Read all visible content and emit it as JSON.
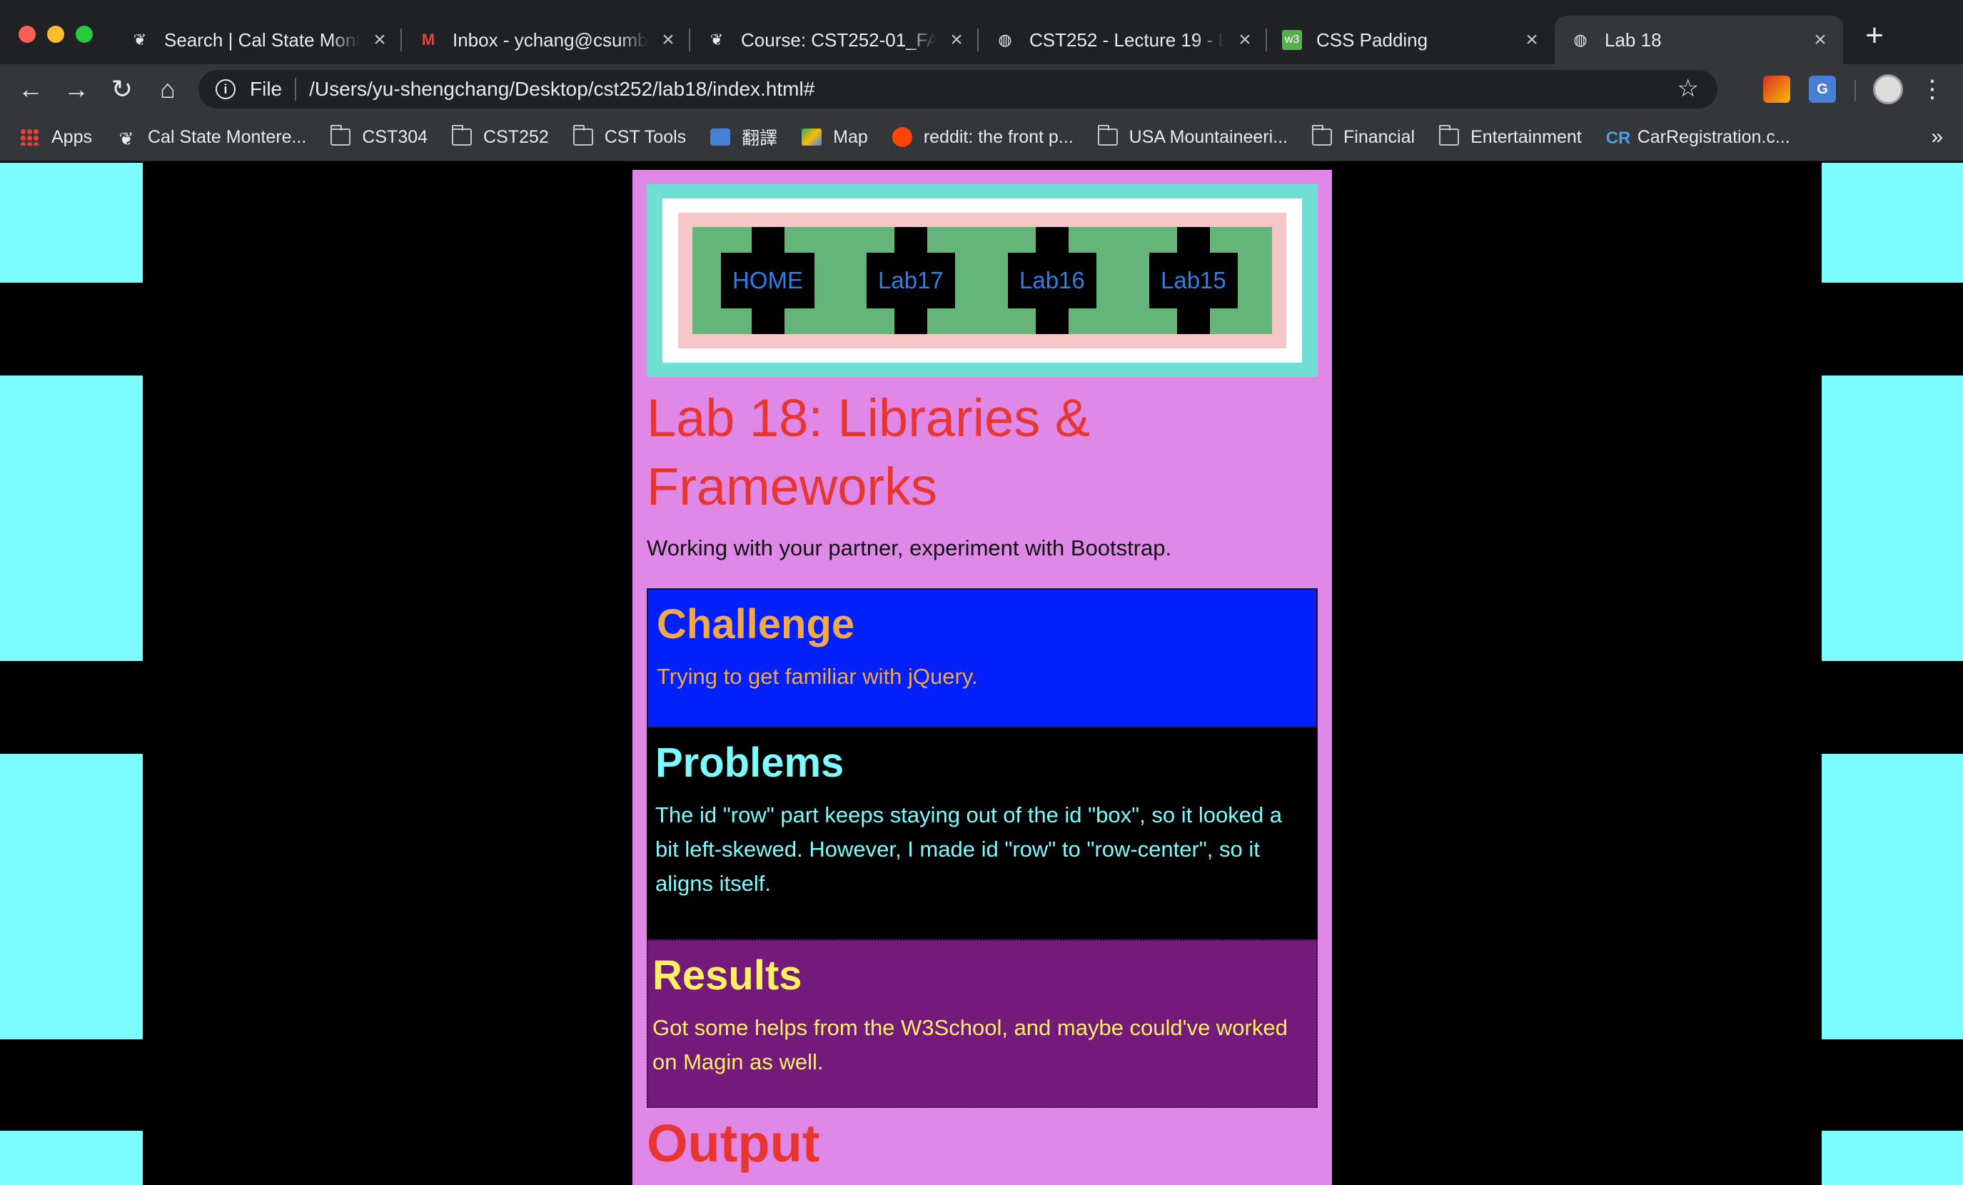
{
  "browser": {
    "tabs": [
      {
        "title": "Search | Cal State Monterey Bay",
        "icon": "csumb-icon"
      },
      {
        "title": "Inbox - ychang@csumb.edu",
        "icon": "gmail-icon"
      },
      {
        "title": "Course: CST252-01_FA19",
        "icon": "csumb-icon"
      },
      {
        "title": "CST252 - Lecture 19 - Libraries",
        "icon": "globe-icon"
      },
      {
        "title": "CSS Padding",
        "icon": "w3schools-icon"
      },
      {
        "title": "Lab 18",
        "icon": "globe-icon"
      }
    ],
    "omnibox": {
      "scheme_label": "File",
      "url": "/Users/yu-shengchang/Desktop/cst252/lab18/index.html#"
    },
    "bookmarks": [
      {
        "label": "Apps",
        "icon": "apps-icon"
      },
      {
        "label": "Cal State Montere...",
        "icon": "csumb-icon"
      },
      {
        "label": "CST304",
        "icon": "folder-icon"
      },
      {
        "label": "CST252",
        "icon": "folder-icon"
      },
      {
        "label": "CST Tools",
        "icon": "folder-icon"
      },
      {
        "label": "翻譯",
        "icon": "google-translate-icon"
      },
      {
        "label": "Map",
        "icon": "maps-icon"
      },
      {
        "label": "reddit: the front p...",
        "icon": "reddit-icon"
      },
      {
        "label": "USA Mountaineeri...",
        "icon": "folder-icon"
      },
      {
        "label": "Financial",
        "icon": "folder-icon"
      },
      {
        "label": "Entertainment",
        "icon": "folder-icon"
      },
      {
        "label": "CarRegistration.c...",
        "icon": "carregistration-icon"
      }
    ]
  },
  "page": {
    "nav": [
      "HOME",
      "Lab17",
      "Lab16",
      "Lab15"
    ],
    "title": "Lab 18: Libraries & Frameworks",
    "lead": "Working with your partner, experiment with Bootstrap.",
    "challenge": {
      "heading": "Challenge",
      "text": "Trying to get familiar with jQuery."
    },
    "problems": {
      "heading": "Problems",
      "text": "The id \"row\" part keeps staying out of the id \"box\", so it looked a bit left-skewed. However, I made id \"row\" to \"row-center\", so it aligns itself."
    },
    "results": {
      "heading": "Results",
      "text": "Got some helps from the W3School, and maybe could've worked on Magin as well."
    },
    "output_heading": "Output"
  },
  "colors": {
    "page_background": "#000000",
    "side_bands": "#7cfcfe",
    "container": "#df88e8",
    "title": "#e8352f",
    "nav_link": "#2f7fef",
    "challenge_bg": "#0120fc",
    "challenge_text": "#f0a848",
    "problems_text": "#7cfcfe",
    "results_bg": "#731a7a",
    "results_text": "#ffef63"
  }
}
